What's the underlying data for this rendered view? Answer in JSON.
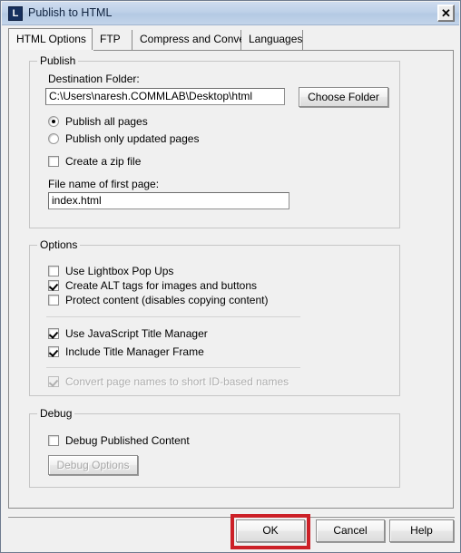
{
  "window": {
    "title": "Publish to HTML",
    "app_icon": "L",
    "app_icon_name": "lectora-app-icon",
    "close_label": "✕"
  },
  "tabs": [
    {
      "label": "HTML Options",
      "active": true
    },
    {
      "label": "FTP",
      "active": false
    },
    {
      "label": "Compress and Convert",
      "active": false
    },
    {
      "label": "Languages",
      "active": false
    }
  ],
  "publish_group": {
    "legend": "Publish",
    "destination_label": "Destination Folder:",
    "destination_value": "C:\\Users\\naresh.COMMLAB\\Desktop\\html",
    "choose_folder_label": "Choose Folder",
    "radios": [
      {
        "label": "Publish all pages",
        "checked": true
      },
      {
        "label": "Publish only updated pages",
        "checked": false
      }
    ],
    "zip_checkbox": {
      "label": "Create a zip file",
      "checked": false
    },
    "first_page_label": "File name of first page:",
    "first_page_value": "index.html"
  },
  "options_group": {
    "legend": "Options",
    "items_a": [
      {
        "label": "Use Lightbox Pop Ups",
        "checked": false,
        "disabled": false
      },
      {
        "label": "Create ALT tags for images and buttons",
        "checked": true,
        "disabled": false
      },
      {
        "label": "Protect content (disables copying content)",
        "checked": false,
        "disabled": false
      }
    ],
    "items_b": [
      {
        "label": "Use JavaScript Title Manager",
        "checked": true,
        "disabled": false
      },
      {
        "label": "Include Title Manager Frame",
        "checked": true,
        "disabled": false
      }
    ],
    "items_c": [
      {
        "label": "Convert page names to short ID-based names",
        "checked": true,
        "disabled": true
      }
    ]
  },
  "debug_group": {
    "legend": "Debug",
    "checkbox": {
      "label": "Debug Published Content",
      "checked": false
    },
    "button_label": "Debug Options",
    "button_disabled": true
  },
  "footer": {
    "ok_label": "OK",
    "cancel_label": "Cancel",
    "help_label": "Help"
  },
  "annotation": {
    "color": "#cc2027",
    "target": "OK"
  }
}
